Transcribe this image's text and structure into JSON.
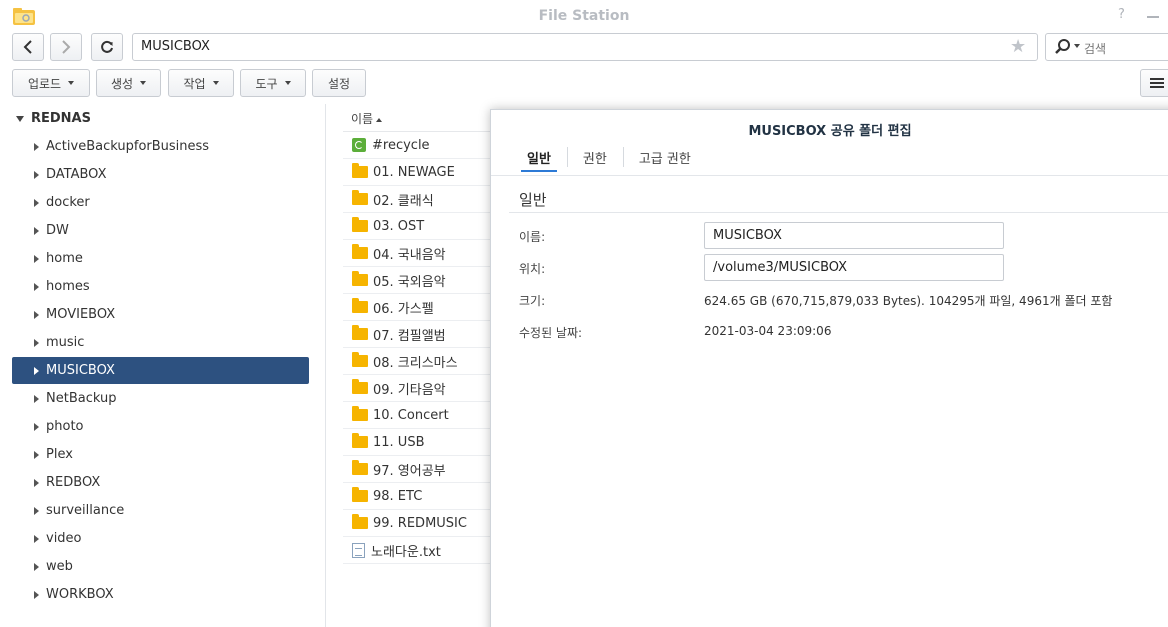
{
  "window": {
    "title": "File Station",
    "help_label": "?"
  },
  "nav": {
    "path": "MUSICBOX",
    "search_placeholder": "검색"
  },
  "toolbar": {
    "upload": "업로드",
    "create": "생성",
    "action": "작업",
    "tools": "도구",
    "settings": "설정"
  },
  "sidebar": {
    "root": "REDNAS",
    "items": [
      "ActiveBackupforBusiness",
      "DATABOX",
      "docker",
      "DW",
      "home",
      "homes",
      "MOVIEBOX",
      "music",
      "MUSICBOX",
      "NetBackup",
      "photo",
      "Plex",
      "REDBOX",
      "surveillance",
      "video",
      "web",
      "WORKBOX"
    ],
    "selected": "MUSICBOX"
  },
  "filelist": {
    "header_name": "이름",
    "rows": [
      {
        "name": "#recycle",
        "icon": "recycle-bin-icon"
      },
      {
        "name": "01. NEWAGE",
        "icon": "folder-icon"
      },
      {
        "name": "02. 클래식",
        "icon": "folder-icon"
      },
      {
        "name": "03. OST",
        "icon": "folder-icon"
      },
      {
        "name": "04. 국내음악",
        "icon": "folder-icon"
      },
      {
        "name": "05. 국외음악",
        "icon": "folder-icon"
      },
      {
        "name": "06. 가스펠",
        "icon": "folder-icon"
      },
      {
        "name": "07. 컴필앨범",
        "icon": "folder-icon"
      },
      {
        "name": "08. 크리스마스",
        "icon": "folder-icon"
      },
      {
        "name": "09. 기타음악",
        "icon": "folder-icon"
      },
      {
        "name": "10. Concert",
        "icon": "folder-icon"
      },
      {
        "name": "11. USB",
        "icon": "folder-icon"
      },
      {
        "name": "97. 영어공부",
        "icon": "folder-icon"
      },
      {
        "name": "98. ETC",
        "icon": "folder-icon"
      },
      {
        "name": "99. REDMUSIC",
        "icon": "folder-icon"
      },
      {
        "name": "노래다운.txt",
        "icon": "text-file-icon"
      }
    ]
  },
  "dialog": {
    "title": "MUSICBOX 공유 폴더 편집",
    "tabs": [
      "일반",
      "권한",
      "고급 권한"
    ],
    "section": "일반",
    "name_label": "이름:",
    "name_value": "MUSICBOX",
    "location_label": "위치:",
    "location_value": "/volume3/MUSICBOX",
    "size_label": "크기:",
    "size_value": "624.65 GB (670,715,879,033 Bytes). 104295개 파일, 4961개 폴더 포함",
    "modified_label": "수정된 날짜:",
    "modified_value": "2021-03-04 23:09:06"
  }
}
